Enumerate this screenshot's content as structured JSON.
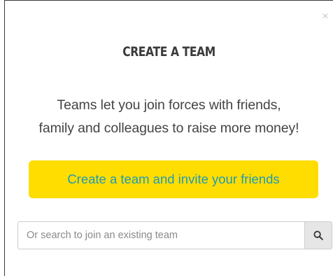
{
  "modal": {
    "close_label": "×",
    "title": "CREATE A TEAM",
    "description_line1": "Teams let you join forces with friends,",
    "description_line2": "family and colleagues to raise more money!",
    "cta_label": "Create a team and invite your friends",
    "search": {
      "placeholder": "Or search to join an existing team",
      "value": "",
      "button_icon": "search-icon"
    }
  },
  "colors": {
    "cta_background": "#ffdd00",
    "cta_text": "#1f9bb5",
    "title_text": "#3a3a3a",
    "body_text": "#444444",
    "close_icon": "#c8c8c8",
    "search_button_background": "#e6e6e6"
  }
}
